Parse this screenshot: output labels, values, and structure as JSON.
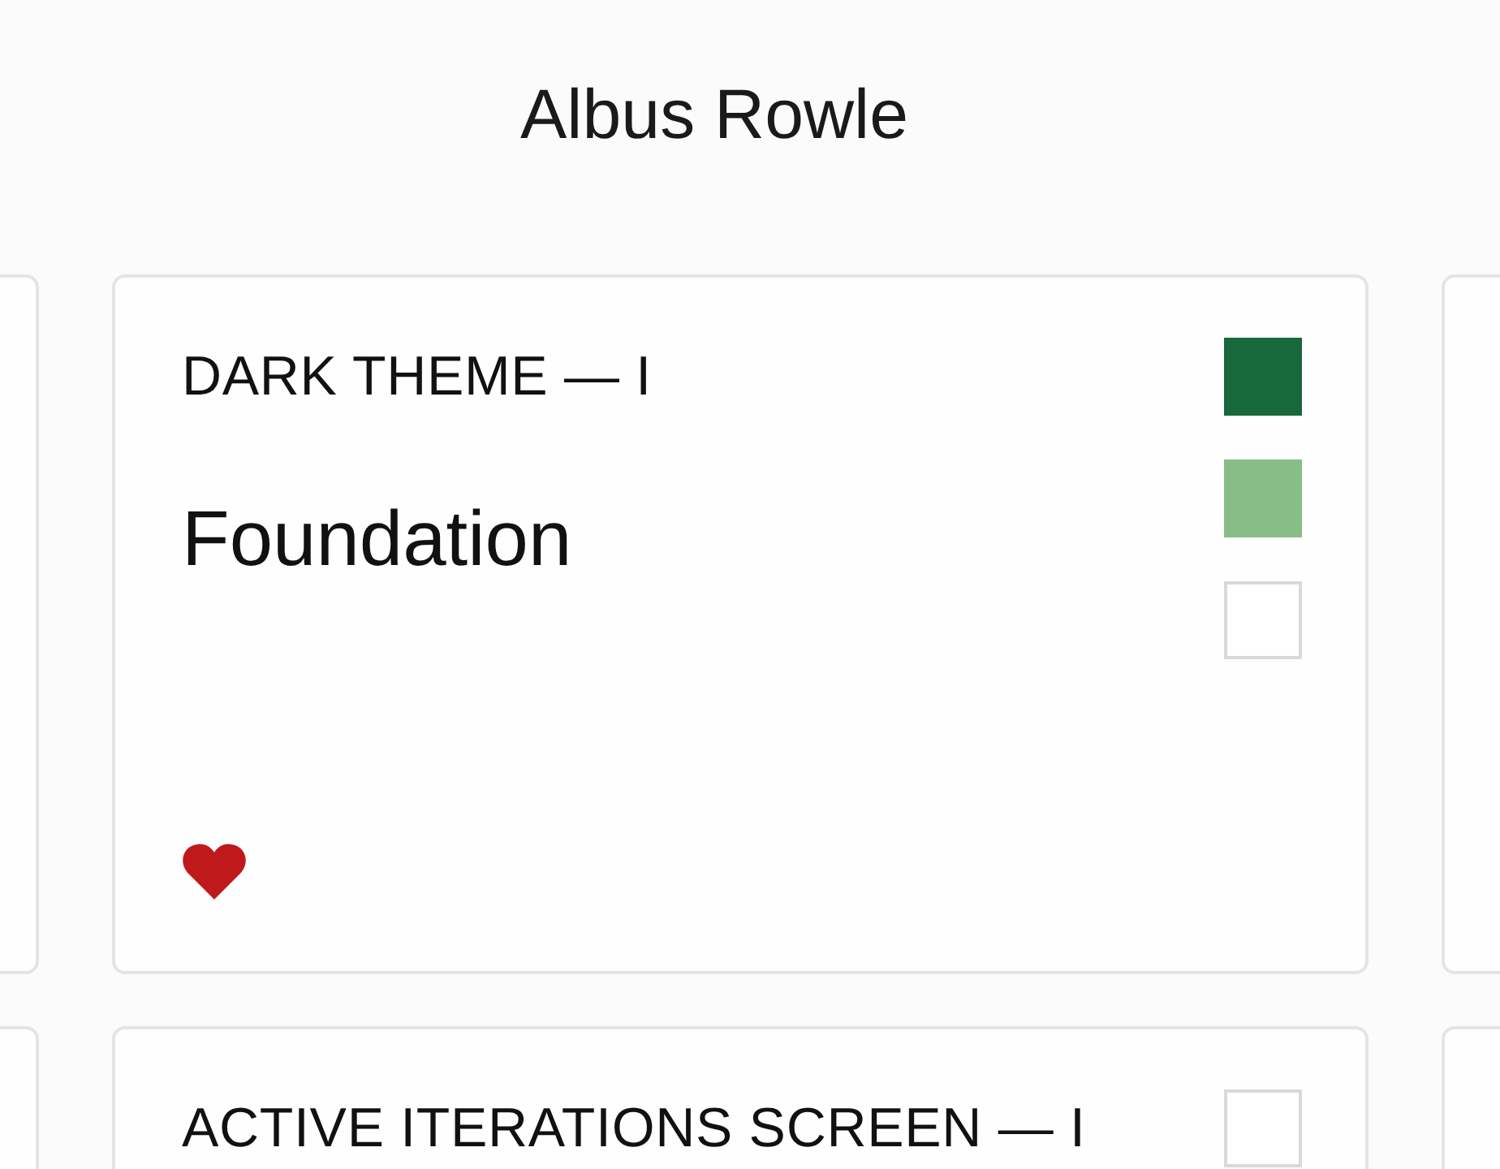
{
  "header": {
    "title": "Albus Rowle"
  },
  "cards": [
    {
      "label": "DARK THEME — I",
      "title": "Foundation",
      "favorite": true,
      "swatches": [
        {
          "filled": true,
          "color": "#17683a"
        },
        {
          "filled": true,
          "color": "#88bd88"
        },
        {
          "filled": false
        }
      ]
    },
    {
      "label": "ACTIVE ITERATIONS SCREEN — I",
      "swatches": [
        {
          "filled": false
        }
      ]
    }
  ]
}
